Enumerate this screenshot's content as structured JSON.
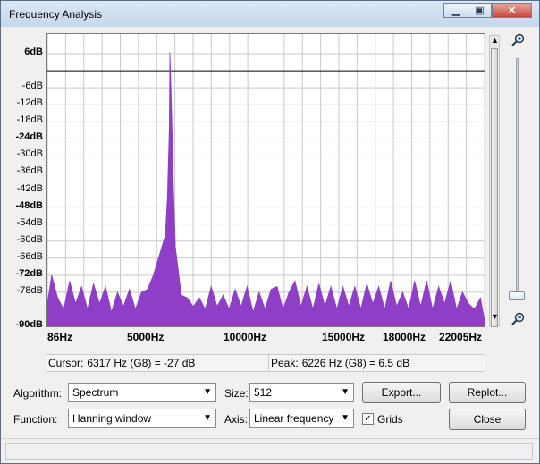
{
  "window": {
    "title": "Frequency Analysis",
    "minimize_icon": "minimize-icon",
    "maximize_icon": "maximize-icon",
    "close_icon": "close-icon"
  },
  "plot": {
    "y_ticks": [
      "6dB",
      "-6dB",
      "-12dB",
      "-18dB",
      "-24dB",
      "-30dB",
      "-36dB",
      "-42dB",
      "-48dB",
      "-54dB",
      "-60dB",
      "-66dB",
      "-72dB",
      "-78dB",
      "-90dB"
    ],
    "bold_ticks": [
      "6dB",
      "-24dB",
      "-48dB",
      "-72dB",
      "-90dB"
    ],
    "x_ticks": [
      "86Hz",
      "5000Hz",
      "10000Hz",
      "15000Hz",
      "18000Hz",
      "22005Hz"
    ],
    "zoom_in_icon": "zoom-in-icon",
    "zoom_out_icon": "zoom-out-icon"
  },
  "chart_data": {
    "type": "area",
    "x_unit": "Hz",
    "y_unit": "dB",
    "xlim": [
      86,
      22005
    ],
    "ylim": [
      -90,
      6
    ],
    "grid": true,
    "series": [
      {
        "color": "#8f3ec7",
        "x": [
          86,
          300,
          600,
          900,
          1200,
          1500,
          1800,
          2100,
          2400,
          2700,
          3000,
          3300,
          3600,
          3900,
          4200,
          4500,
          4800,
          5100,
          5400,
          5700,
          6000,
          6100,
          6200,
          6226,
          6300,
          6400,
          6500,
          6800,
          7100,
          7400,
          7700,
          8000,
          8300,
          8600,
          8900,
          9200,
          9500,
          9800,
          10100,
          10400,
          10700,
          11000,
          11300,
          11600,
          11900,
          12200,
          12500,
          12800,
          13100,
          13400,
          13700,
          14000,
          14300,
          14600,
          14900,
          15200,
          15500,
          15800,
          16100,
          16400,
          16700,
          17000,
          17300,
          17600,
          17900,
          18200,
          18500,
          18800,
          19100,
          19400,
          19700,
          20000,
          20300,
          20600,
          20900,
          21200,
          21500,
          21800,
          22005
        ],
        "y": [
          -82,
          -72,
          -80,
          -84,
          -74,
          -82,
          -76,
          -84,
          -75,
          -82,
          -76,
          -85,
          -78,
          -83,
          -77,
          -84,
          -78,
          -77,
          -72,
          -65,
          -58,
          -45,
          -20,
          6.5,
          -10,
          -40,
          -62,
          -79,
          -80,
          -83,
          -80,
          -84,
          -76,
          -83,
          -79,
          -84,
          -77,
          -83,
          -76,
          -85,
          -78,
          -84,
          -77,
          -76,
          -84,
          -78,
          -74,
          -83,
          -76,
          -84,
          -75,
          -83,
          -76,
          -84,
          -76,
          -83,
          -76,
          -84,
          -75,
          -82,
          -76,
          -84,
          -74,
          -83,
          -78,
          -84,
          -74,
          -83,
          -74,
          -84,
          -76,
          -82,
          -74,
          -84,
          -78,
          -82,
          -84,
          -80,
          -88
        ]
      }
    ]
  },
  "cursor": {
    "label": "Cursor:",
    "value": "6317 Hz (G8) = -27 dB"
  },
  "peak": {
    "label": "Peak:",
    "value": "6226 Hz (G8) = 6.5 dB"
  },
  "controls": {
    "algorithm_label": "Algorithm:",
    "algorithm_value": "Spectrum",
    "size_label": "Size:",
    "size_value": "512",
    "function_label": "Function:",
    "function_value": "Hanning window",
    "axis_label": "Axis:",
    "axis_value": "Linear frequency",
    "grids_label": "Grids",
    "grids_checked": true,
    "export_label": "Export...",
    "replot_label": "Replot...",
    "close_label": "Close"
  }
}
